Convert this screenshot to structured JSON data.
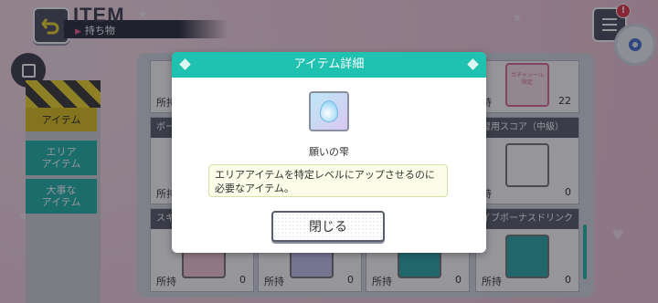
{
  "header": {
    "title": "ITEM",
    "subtitle": "持ち物"
  },
  "notification": {
    "badge": "!"
  },
  "left_tabs": [
    {
      "label": "アイテム",
      "active": true
    },
    {
      "label": "エリア\nアイテム",
      "active": false
    },
    {
      "label": "大事な\nアイテム",
      "active": false
    }
  ],
  "grid": {
    "cells": [
      {
        "head": "",
        "qty_label": "所持",
        "qty": ""
      },
      {
        "head": "",
        "qty_label": "持",
        "qty": "22"
      },
      {
        "head": "ボー",
        "qty_label": "所持",
        "qty": ""
      },
      {
        "head": "習用スコア（中級）",
        "qty_label": "持",
        "qty": "0"
      },
      {
        "head": "スキル",
        "qty_label": "所持",
        "qty": "0"
      },
      {
        "head": "",
        "qty_label": "所持",
        "qty": "0"
      },
      {
        "head": "",
        "qty_label": "所持",
        "qty": "0"
      },
      {
        "head": "イブボーナスドリンク（大）",
        "qty_label": "所持",
        "qty": "0"
      }
    ],
    "gacha_tag": "ガチャシール\n限定"
  },
  "modal": {
    "title": "アイテム詳細",
    "item_name": "願いの雫",
    "description": "エリアアイテムを特定レベルにアップさせるのに必要なアイテム。",
    "close_label": "閉じる"
  },
  "colors": {
    "accent": "#1fc1b0",
    "tab_active": "#e0c31c",
    "alert": "#e8334a"
  }
}
